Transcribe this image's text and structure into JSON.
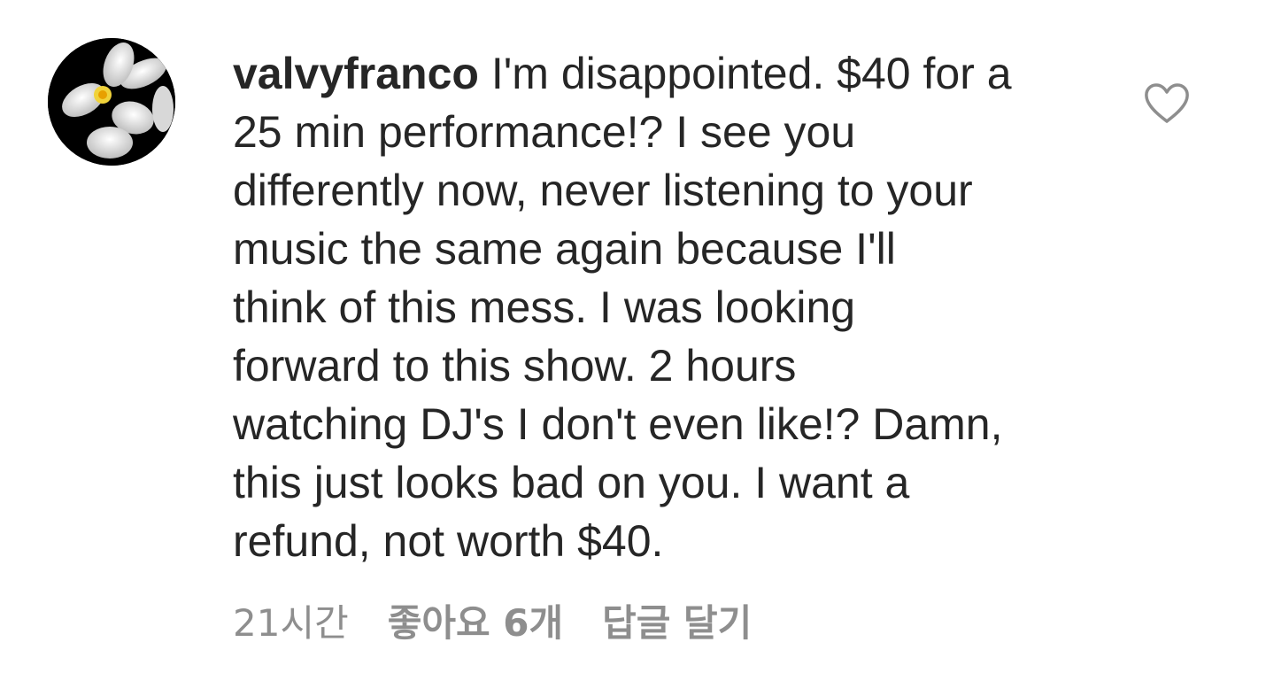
{
  "comment": {
    "username": "valvyfranco",
    "text_lines": [
      "I'm disappointed. $40 for a",
      "25 min performance!? I see you",
      "differently now, never listening to your",
      "music the same again because I'll",
      "think of this mess. I was looking",
      "forward to this show. 2 hours",
      "watching DJ's I don't even like!? Damn,",
      "this just looks bad on you. I want a",
      "refund, not worth $40."
    ],
    "time_ago": "21시간",
    "likes": "좋아요 6개",
    "reply_label": "답글 달기",
    "icons": {
      "avatar": "avatar-orchid",
      "like": "heart-outline-icon"
    },
    "colors": {
      "text": "#262626",
      "meta": "#8e8e8e",
      "icon": "#8e8e8e"
    }
  }
}
